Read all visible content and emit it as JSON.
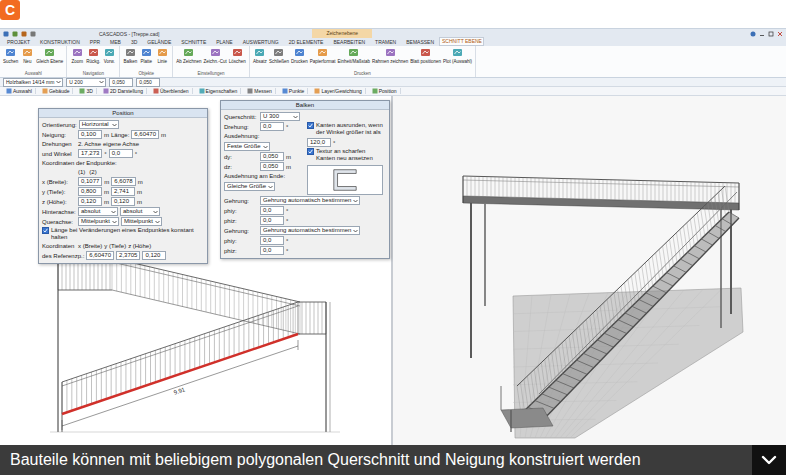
{
  "logo": {
    "letter": "C"
  },
  "window": {
    "title": "CASCADOS - [Treppe.cad]",
    "context_label": "Zeichenebene"
  },
  "ribbon_tabs": [
    {
      "label": "PROJEKT",
      "selected": false
    },
    {
      "label": "KONSTRUKTION",
      "selected": false
    },
    {
      "label": "PPR",
      "selected": false
    },
    {
      "label": "MEB",
      "selected": false
    },
    {
      "label": "3D",
      "selected": false
    },
    {
      "label": "GELÄNDE",
      "selected": false
    },
    {
      "label": "SCHNITTE",
      "selected": false
    },
    {
      "label": "PLANE",
      "selected": false
    },
    {
      "label": "AUSWERTUNG",
      "selected": false
    },
    {
      "label": "2D ELEMENTE",
      "selected": false
    },
    {
      "label": "BEARBEITEN",
      "selected": false
    },
    {
      "label": "TRAMEN",
      "selected": false
    },
    {
      "label": "BEMASSEN",
      "selected": false
    },
    {
      "label": "SCHNITT EBENE",
      "selected": true
    }
  ],
  "ribbon_groups": [
    {
      "label": "Auswahl",
      "buttons": [
        "Suchen",
        "Neu",
        "Gleich Ebene"
      ]
    },
    {
      "label": "Navigation",
      "buttons": [
        "Zoom",
        "Rückg.",
        "Vorw."
      ]
    },
    {
      "label": "Objekte",
      "buttons": [
        "Balken",
        "Platte",
        "Linie"
      ]
    },
    {
      "label": "Einstellungen",
      "buttons": [
        "Ab Zeichnen",
        "Zeichn.-Cut",
        "Löschen"
      ]
    },
    {
      "label": "Drucken",
      "buttons": [
        "Absatz",
        "Schließen",
        "Drucken",
        "Papierformat",
        "Einheit/Maßstab",
        "Rahmen zeichnen",
        "Blatt positionen",
        "Plot (Auswahl)"
      ]
    }
  ],
  "toolbar1": [
    {
      "kind": "select",
      "text": "Holzbalken 14/14 mm"
    },
    {
      "kind": "select",
      "text": "U 200"
    },
    {
      "kind": "input",
      "text": "0,050"
    },
    {
      "kind": "input",
      "text": "0,050"
    }
  ],
  "toolbar2": [
    "Auswahl",
    "Gebäude",
    "3D",
    "2D Darstellung",
    "Überblenden",
    "Eigenschaften",
    "Messen",
    "Punkte",
    "Layer/Gewichtung",
    "Position"
  ],
  "position_dialog": {
    "title": "Position",
    "rows": [
      [
        {
          "kind": "label",
          "text": "Orientierung:"
        },
        {
          "kind": "select",
          "text": "Horizontal"
        }
      ],
      [
        {
          "kind": "label",
          "text": "Neigung:"
        },
        {
          "kind": "input",
          "text": "0,100"
        },
        {
          "kind": "label",
          "text": "m"
        },
        {
          "kind": "label",
          "text": "Länge:"
        },
        {
          "kind": "input",
          "text": "6,60470"
        },
        {
          "kind": "label",
          "text": "m"
        }
      ],
      [
        {
          "kind": "label",
          "text": "Drehungen"
        },
        {
          "kind": "label",
          "text": "2. Achse"
        },
        {
          "kind": "label",
          "text": "eigene Achse"
        }
      ],
      [
        {
          "kind": "label",
          "text": "und Winkel"
        },
        {
          "kind": "input",
          "text": "17,273"
        },
        {
          "kind": "label",
          "text": "°"
        },
        {
          "kind": "input",
          "text": "0,0"
        },
        {
          "kind": "label",
          "text": "°"
        }
      ],
      [
        {
          "kind": "label",
          "text": "Koordinaten der Endpunkte:"
        }
      ],
      [
        {
          "kind": "spacer"
        },
        {
          "kind": "label",
          "text": "(1)"
        },
        {
          "kind": "spacer"
        },
        {
          "kind": "label",
          "text": "(2)"
        }
      ],
      [
        {
          "kind": "label",
          "text": "x (Breite):"
        },
        {
          "kind": "input",
          "text": "0,1077"
        },
        {
          "kind": "label",
          "text": "m"
        },
        {
          "kind": "input",
          "text": "6,6078"
        },
        {
          "kind": "label",
          "text": "m"
        }
      ],
      [
        {
          "kind": "label",
          "text": "y (Tiefe):"
        },
        {
          "kind": "input",
          "text": "0,800"
        },
        {
          "kind": "label",
          "text": "m"
        },
        {
          "kind": "input",
          "text": "2,741"
        },
        {
          "kind": "label",
          "text": "m"
        }
      ],
      [
        {
          "kind": "label",
          "text": "z (Höhe):"
        },
        {
          "kind": "input",
          "text": "0,120"
        },
        {
          "kind": "label",
          "text": "m"
        },
        {
          "kind": "input",
          "text": "0,120"
        },
        {
          "kind": "label",
          "text": "m"
        }
      ],
      [
        {
          "kind": "label",
          "text": "Hinterachse:"
        },
        {
          "kind": "select",
          "text": "absolut"
        },
        {
          "kind": "select",
          "text": "absolut"
        }
      ],
      [
        {
          "kind": "label",
          "text": "Querachse:"
        },
        {
          "kind": "select",
          "text": "Mittelpunkt"
        },
        {
          "kind": "select",
          "text": "Mittelpunkt"
        }
      ],
      [
        {
          "kind": "check",
          "text": "Länge bei Veränderungen eines Endpunktes konstant halten",
          "checked": true
        }
      ],
      [
        {
          "kind": "label",
          "text": "Koordinaten"
        },
        {
          "kind": "label",
          "text": "x (Breite)"
        },
        {
          "kind": "label",
          "text": "y (Tiefe)"
        },
        {
          "kind": "label",
          "text": "z (Höhe)"
        }
      ],
      [
        {
          "kind": "label",
          "text": "des Referenzp.:"
        },
        {
          "kind": "input",
          "text": "6,60470"
        },
        {
          "kind": "input",
          "text": "2,3705"
        },
        {
          "kind": "input",
          "text": "0,120"
        }
      ]
    ]
  },
  "balken_dialog": {
    "title": "Balken",
    "rows_top": [
      [
        {
          "kind": "label",
          "text": "Querschnitt:"
        },
        {
          "kind": "select",
          "text": "U 300"
        }
      ]
    ],
    "rows_left": [
      [
        {
          "kind": "label",
          "text": "Drehung:"
        },
        {
          "kind": "input",
          "text": "0,0"
        },
        {
          "kind": "label",
          "text": "°"
        }
      ],
      [
        {
          "kind": "label",
          "text": "Ausdehnung:"
        },
        {
          "kind": "select",
          "text": "Feste Größe"
        }
      ],
      [
        {
          "kind": "label",
          "text": "dy:"
        },
        {
          "kind": "input",
          "text": "0,050"
        },
        {
          "kind": "label",
          "text": "m"
        }
      ],
      [
        {
          "kind": "label",
          "text": "dz:"
        },
        {
          "kind": "input",
          "text": "0,050"
        },
        {
          "kind": "label",
          "text": "m"
        }
      ],
      [
        {
          "kind": "label",
          "text": "Ausdehnung am Ende:"
        },
        {
          "kind": "select",
          "text": "Gleiche Größe"
        }
      ]
    ],
    "rows_right": [
      [
        {
          "kind": "check",
          "text": "Kanten ausrunden, wenn der Winkel größer ist als",
          "checked": true
        },
        {
          "kind": "input",
          "text": "120,0"
        },
        {
          "kind": "label",
          "text": "°"
        }
      ],
      [
        {
          "kind": "check",
          "text": "Textur an scharfen Kanten neu ansetzen",
          "checked": true
        }
      ]
    ],
    "rows_bottom": [
      [
        {
          "kind": "label",
          "text": "Gehrung:"
        },
        {
          "kind": "select",
          "text": "Gehrung automatisch bestimmen"
        }
      ],
      [
        {
          "kind": "label",
          "text": "phiy:"
        },
        {
          "kind": "input",
          "text": "0,0"
        },
        {
          "kind": "label",
          "text": "°"
        }
      ],
      [
        {
          "kind": "label",
          "text": "phiz:"
        },
        {
          "kind": "input",
          "text": "0,0"
        },
        {
          "kind": "label",
          "text": "°"
        }
      ],
      [
        {
          "kind": "label",
          "text": "Gehrung:"
        },
        {
          "kind": "select",
          "text": "Gehrung automatisch bestimmen"
        }
      ],
      [
        {
          "kind": "label",
          "text": "phiy:"
        },
        {
          "kind": "input",
          "text": "0,0"
        },
        {
          "kind": "label",
          "text": "°"
        }
      ],
      [
        {
          "kind": "label",
          "text": "phiz:"
        },
        {
          "kind": "input",
          "text": "0,0"
        },
        {
          "kind": "label",
          "text": "°"
        }
      ]
    ]
  },
  "drawing": {
    "dimension": "9.91"
  },
  "caption": {
    "text": "Bauteile können mit beliebigem polygonalen Querschnitt und Neigung konstruiert werden"
  }
}
